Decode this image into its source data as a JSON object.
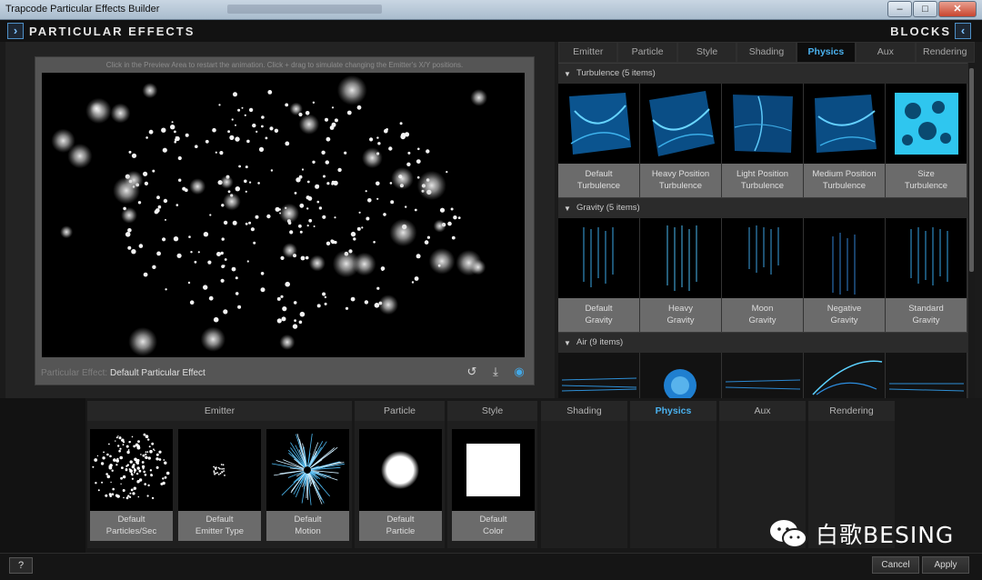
{
  "window": {
    "title": "Trapcode Particular Effects Builder",
    "controls": [
      "minimize-icon",
      "maximize-icon",
      "close-icon"
    ]
  },
  "header": {
    "title": "PARTICULAR EFFECTS",
    "blocks_label": "BLOCKS",
    "left_arrow": "›",
    "right_arrow": "‹"
  },
  "preview": {
    "hint": "Click in the Preview Area to restart the animation. Click + drag to simulate changing the Emitter's X/Y positions.",
    "effect_prefix": "Particular Effect:",
    "effect_name": "Default Particular Effect",
    "icons": [
      "restart-icon",
      "save-icon",
      "info-icon"
    ]
  },
  "blocks": {
    "tabs": [
      "Emitter",
      "Particle",
      "Style",
      "Shading",
      "Physics",
      "Aux",
      "Rendering"
    ],
    "active_tab": "Physics",
    "sections": [
      {
        "title": "Turbulence",
        "count": "(5 items)",
        "items": [
          {
            "line1": "Default",
            "line2": "Turbulence"
          },
          {
            "line1": "Heavy Position",
            "line2": "Turbulence"
          },
          {
            "line1": "Light Position",
            "line2": "Turbulence"
          },
          {
            "line1": "Medium Position",
            "line2": "Turbulence"
          },
          {
            "line1": "Size",
            "line2": "Turbulence"
          }
        ]
      },
      {
        "title": "Gravity",
        "count": "(5 items)",
        "items": [
          {
            "line1": "Default",
            "line2": "Gravity"
          },
          {
            "line1": "Heavy",
            "line2": "Gravity"
          },
          {
            "line1": "Moon",
            "line2": "Gravity"
          },
          {
            "line1": "Negative",
            "line2": "Gravity"
          },
          {
            "line1": "Standard",
            "line2": "Gravity"
          }
        ]
      },
      {
        "title": "Air",
        "count": "(9 items)",
        "items": []
      }
    ]
  },
  "design": {
    "columns": [
      "Emitter",
      "Particle",
      "Style",
      "Shading",
      "Physics",
      "Aux",
      "Rendering"
    ],
    "active_column": "Physics",
    "blocks": [
      {
        "line1": "Default",
        "line2": "Particles/Sec"
      },
      {
        "line1": "Default",
        "line2": "Emitter Type"
      },
      {
        "line1": "Default",
        "line2": "Motion"
      },
      {
        "line1": "Default",
        "line2": "Particle"
      },
      {
        "line1": "Default",
        "line2": "Color"
      }
    ]
  },
  "footer": {
    "help": "?",
    "cancel": "Cancel",
    "apply": "Apply"
  },
  "watermark": {
    "text": "白歌BESING"
  },
  "colors": {
    "accent": "#4ab1ee",
    "titlebar": "#b9c9d9"
  }
}
